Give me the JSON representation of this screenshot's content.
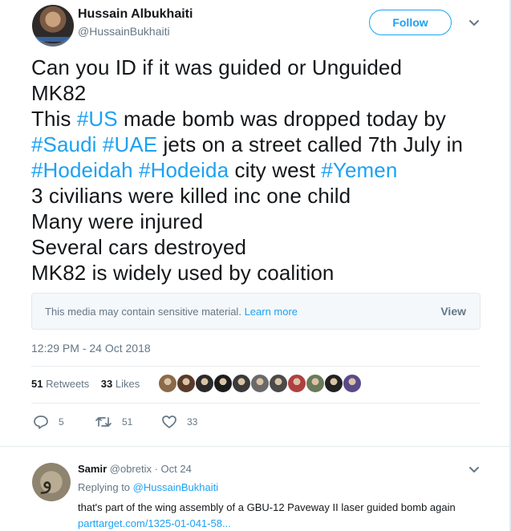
{
  "author": {
    "name": "Hussain Albukhaiti",
    "handle": "@HussainBukhaiti",
    "follow_label": "Follow"
  },
  "tweet": {
    "lines": [
      [
        {
          "t": "Can you ID if it was guided or Unguided",
          "tag": false
        }
      ],
      [
        {
          "t": "MK82",
          "tag": false
        }
      ],
      [
        {
          "t": "This ",
          "tag": false
        },
        {
          "t": "#US",
          "tag": true
        },
        {
          "t": " made bomb was dropped today by",
          "tag": false
        }
      ],
      [
        {
          "t": "#Saudi",
          "tag": true
        },
        {
          "t": " ",
          "tag": false
        },
        {
          "t": "#UAE",
          "tag": true
        },
        {
          "t": " jets on a street called 7th July in",
          "tag": false
        }
      ],
      [
        {
          "t": "#Hodeidah",
          "tag": true
        },
        {
          "t": " ",
          "tag": false
        },
        {
          "t": "#Hodeida",
          "tag": true
        },
        {
          "t": " city west ",
          "tag": false
        },
        {
          "t": "#Yemen",
          "tag": true
        }
      ],
      [
        {
          "t": "3 civilians were killed inc one child",
          "tag": false
        }
      ],
      [
        {
          "t": "Many were injured",
          "tag": false
        }
      ],
      [
        {
          "t": "Several cars destroyed",
          "tag": false
        }
      ],
      [
        {
          "t": "MK82 is widely used by coalition",
          "tag": false
        }
      ]
    ],
    "sensitive_notice": "This media may contain sensitive material.",
    "learn_more": "Learn more",
    "view_label": "View",
    "timestamp": "12:29 PM - 24 Oct 2018",
    "retweets_count": "51",
    "retweets_label": "Retweets",
    "likes_count": "33",
    "likes_label": "Likes",
    "actions": {
      "reply_count": "5",
      "retweet_count": "51",
      "like_count": "33"
    }
  },
  "liker_avatar_colors": [
    "#8a6a4a",
    "#5a3a2a",
    "#2a2a2a",
    "#1c1c1c",
    "#3a3a3a",
    "#6a6a6a",
    "#4a4a4a",
    "#b04040",
    "#6a7a5a",
    "#222222",
    "#5a4a8a"
  ],
  "reply": {
    "name": "Samir",
    "handle": "@obretix",
    "date": "· Oct 24",
    "replying_prefix": "Replying to",
    "replying_to": "@HussainBukhaiti",
    "text": "that's part of the wing assembly of a GBU-12 Paveway II laser guided bomb again",
    "link": "parttarget.com/1325-01-041-58..."
  },
  "colors": {
    "accent": "#1da1f2",
    "muted": "#657786",
    "text": "#14171a",
    "border": "#e6ecf0"
  }
}
